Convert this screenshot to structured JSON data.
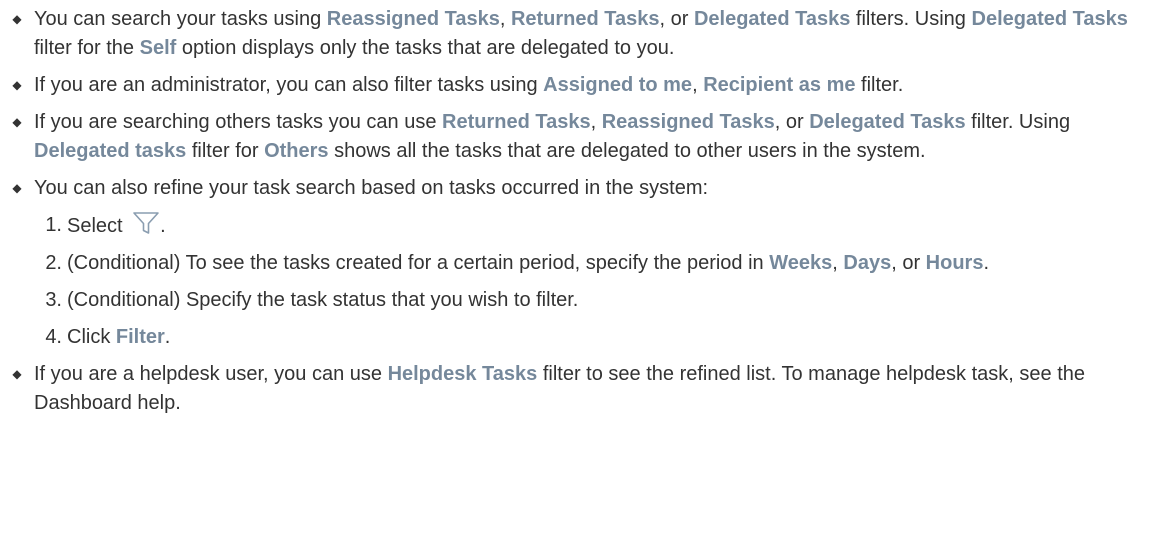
{
  "bullet_glyph": "◆",
  "item1": {
    "t1": "You can search your tasks using ",
    "k1": "Reassigned Tasks",
    "t2": ", ",
    "k2": "Returned Tasks",
    "t3": ", or ",
    "k3": "Delegated Tasks",
    "t4": " filters. Using ",
    "k4": "Delegated Tasks",
    "t5": " filter for the ",
    "k5": "Self",
    "t6": " option displays only the tasks that are delegated to you."
  },
  "item2": {
    "t1": "If you are an administrator, you can also filter tasks using ",
    "k1": "Assigned to me",
    "t2": ", ",
    "k2": "Recipient as me",
    "t3": " filter."
  },
  "item3": {
    "t1": "If you are searching others tasks you can use ",
    "k1": "Returned Tasks",
    "t2": ", ",
    "k2": "Reassigned Tasks",
    "t3": ", or ",
    "k3": "Delegated Tasks",
    "t4": " filter. Using ",
    "k4": "Delegated tasks",
    "t5": " filter for ",
    "k5": "Others",
    "t6": " shows all the tasks that are delegated to other users in the system."
  },
  "item4": {
    "intro": "You can also refine your task search based on tasks occurred in the system:",
    "steps": [
      {
        "num": "1.",
        "t1": "Select ",
        "icon": "filter-funnel-icon",
        "t2": "."
      },
      {
        "num": "2.",
        "t1": "(Conditional) To see the tasks created for a certain period, specify the period in ",
        "k1": "Weeks",
        "t2": ", ",
        "k2": "Days",
        "t3": ", or ",
        "k3": "Hours",
        "t4": "."
      },
      {
        "num": "3.",
        "t1": "(Conditional) Specify the task status that you wish to filter."
      },
      {
        "num": "4.",
        "t1": "Click ",
        "k1": "Filter",
        "t2": "."
      }
    ]
  },
  "item5": {
    "t1": "If you are a helpdesk user, you can use ",
    "k1": "Helpdesk Tasks",
    "t2": " filter to see the refined list. To manage helpdesk task, see the Dashboard help."
  },
  "colors": {
    "text": "#333333",
    "term": "#75889b",
    "icon_stroke": "#8a9db0"
  }
}
